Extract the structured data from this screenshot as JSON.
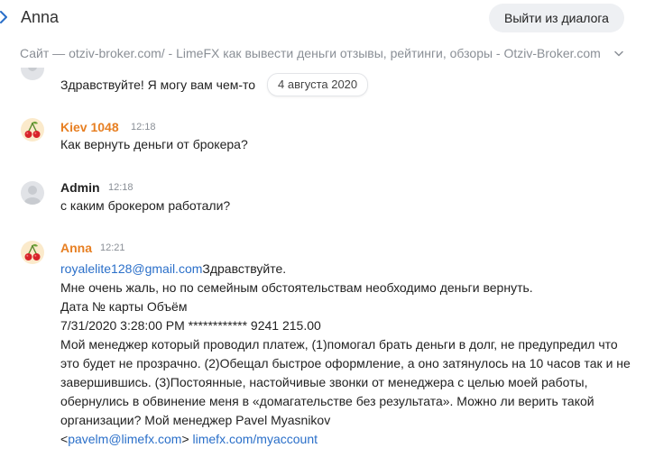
{
  "header": {
    "contact_name": "Anna",
    "exit_button": "Выйти из диалога"
  },
  "site_line": "Сайт — otziv-broker.com/ - LimeFX как вывести деньги отзывы, рейтинги, обзоры - Otziv-Broker.com",
  "messages": {
    "first": {
      "text": "Здравствуйте! Я могу вам чем-то",
      "date_pill": "4 августа 2020"
    },
    "kiev": {
      "sender": "Kiev 1048",
      "time": "12:18",
      "text": "Как вернуть деньги от брокера?"
    },
    "admin": {
      "sender": "Admin",
      "time": "12:18",
      "text": "с каким брокером работали?"
    },
    "anna": {
      "sender": "Anna",
      "time": "12:21",
      "email": "royalelite128@gmail.com",
      "greeting": "Здравствуйте.",
      "line2": "Мне очень жаль, но по семейным обстоятельствам необходимо деньги вернуть.",
      "line3": "Дата № карты Объём",
      "line4": "7/31/2020 3:28:00 PM ************ 9241 215.00",
      "paragraph": "Мой менеджер который проводил платеж, (1)помогал брать деньги в долг, не предупредил что это будет не прозрачно. (2)Обещал быстрое оформление, а оно затянулось на 10 часов так и не завершившись. (3)Постоянные, настойчивые звонки от менеджера с целью моей работы, обернулись в обвинение меня в «домагательстве без результата». Можно ли верить такой организации? Мой менеджер Pavel Myasnikov",
      "lt": "<",
      "manager_email": "pavelm@limefx.com",
      "gt": "> ",
      "account_link": "limefx.com/myaccount"
    }
  },
  "colors": {
    "accent_orange": "#e77f22",
    "link_blue": "#2a6fc9",
    "button_bg": "#eef0f3",
    "muted_text": "#8a8f96"
  },
  "icons": {
    "back": "chevron-right-icon",
    "expand": "chevron-down-icon",
    "avatar_cherry": "cherry-icon",
    "avatar_default": "person-icon"
  }
}
